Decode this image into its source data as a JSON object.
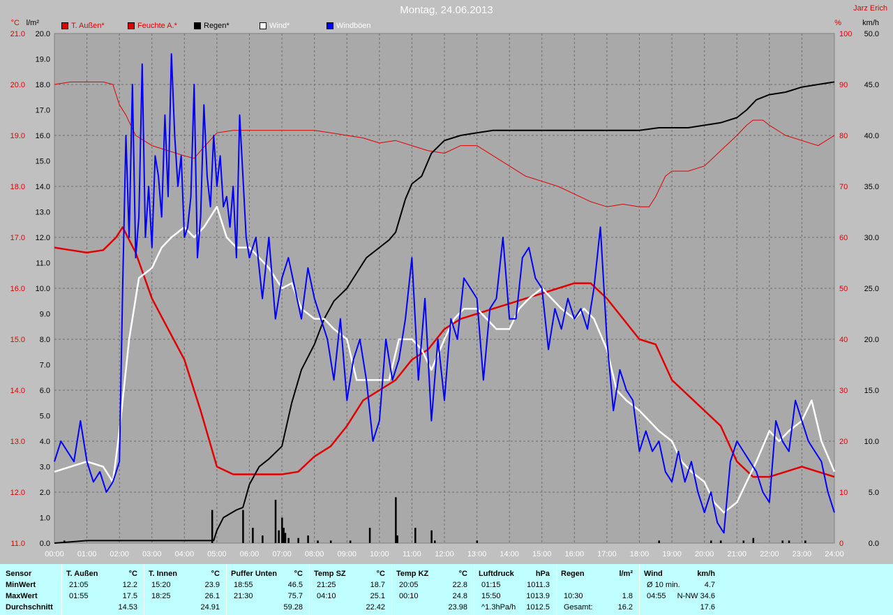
{
  "title": "Montag, 24.06.2013",
  "author": "Jarz Erich",
  "units": {
    "left_temp": "°C",
    "left_rain": "l/m²",
    "right_humidity": "%",
    "right_wind": "km/h"
  },
  "legend": [
    {
      "label": "T. Außen*",
      "color": "#e00000",
      "text_color": "#e00000"
    },
    {
      "label": "Feuchte A.*",
      "color": "#e00000",
      "text_color": "#e00000"
    },
    {
      "label": "Regen*",
      "color": "#000000",
      "text_color": "#000000"
    },
    {
      "label": "Wind*",
      "color": "#ffffff",
      "text_color": "#ffffff"
    },
    {
      "label": "Windböen",
      "color": "#0000ff",
      "text_color": "#ffffff"
    }
  ],
  "chart_data": {
    "type": "line",
    "title": "Montag, 24.06.2013",
    "grid": true,
    "legend_position": "top",
    "x_ticks": [
      "00:00",
      "01:00",
      "02:00",
      "03:00",
      "04:00",
      "05:00",
      "06:00",
      "07:00",
      "08:00",
      "09:00",
      "10:00",
      "11:00",
      "12:00",
      "13:00",
      "14:00",
      "15:00",
      "16:00",
      "17:00",
      "18:00",
      "19:00",
      "20:00",
      "21:00",
      "22:00",
      "23:00",
      "24:00"
    ],
    "xlim": [
      0,
      24
    ],
    "axes": {
      "temp": {
        "unit": "°C",
        "ylim": [
          11.0,
          21.0
        ],
        "ticks": [
          "11.0",
          "12.0",
          "13.0",
          "14.0",
          "15.0",
          "16.0",
          "17.0",
          "18.0",
          "19.0",
          "20.0",
          "21.0"
        ]
      },
      "rain": {
        "unit": "l/m²",
        "ylim": [
          0.0,
          20.0
        ],
        "ticks": [
          "0.0",
          "1.0",
          "2.0",
          "3.0",
          "4.0",
          "5.0",
          "6.0",
          "7.0",
          "8.0",
          "9.0",
          "10.0",
          "11.0",
          "12.0",
          "13.0",
          "14.0",
          "15.0",
          "16.0",
          "17.0",
          "18.0",
          "19.0",
          "20.0"
        ]
      },
      "humidity": {
        "unit": "%",
        "ylim": [
          0,
          100
        ],
        "ticks": [
          "0",
          "10",
          "20",
          "30",
          "40",
          "50",
          "60",
          "70",
          "80",
          "90",
          "100"
        ]
      },
      "wind": {
        "unit": "km/h",
        "ylim": [
          0.0,
          50.0
        ],
        "ticks": [
          "0.0",
          "5.0",
          "10.0",
          "15.0",
          "20.0",
          "25.0",
          "30.0",
          "35.0",
          "40.0",
          "45.0",
          "50.0"
        ]
      }
    },
    "series": [
      {
        "name": "T. Außen*",
        "axis": "temp",
        "color": "#e00000",
        "width": 2.5,
        "x": [
          0,
          0.5,
          1,
          1.5,
          1.9,
          2.1,
          2.5,
          3,
          3.5,
          4,
          4.5,
          5,
          5.5,
          6,
          6.5,
          7,
          7.5,
          8,
          8.5,
          9,
          9.5,
          10,
          10.5,
          11,
          11.5,
          12,
          12.5,
          13,
          13.5,
          14,
          14.5,
          15,
          15.5,
          16,
          16.5,
          17,
          17.5,
          18,
          18.5,
          19,
          19.5,
          20,
          20.5,
          21,
          21.5,
          22,
          22.5,
          23,
          23.5,
          24
        ],
        "y": [
          16.8,
          16.75,
          16.7,
          16.75,
          17.0,
          17.2,
          16.7,
          15.8,
          15.2,
          14.6,
          13.6,
          12.5,
          12.35,
          12.35,
          12.35,
          12.35,
          12.4,
          12.7,
          12.9,
          13.3,
          13.8,
          14.0,
          14.2,
          14.6,
          14.8,
          15.2,
          15.4,
          15.5,
          15.6,
          15.7,
          15.8,
          15.9,
          16.0,
          16.1,
          16.1,
          15.8,
          15.4,
          15.0,
          14.9,
          14.2,
          13.9,
          13.6,
          13.3,
          12.6,
          12.3,
          12.3,
          12.4,
          12.5,
          12.4,
          12.3
        ]
      },
      {
        "name": "Feuchte A.*",
        "axis": "humidity",
        "color": "#e00000",
        "width": 1,
        "x": [
          0,
          0.5,
          1,
          1.5,
          1.8,
          2,
          2.2,
          2.5,
          3,
          3.5,
          4,
          4.3,
          4.5,
          5,
          5.5,
          6,
          6.5,
          7,
          7.5,
          8,
          8.5,
          9,
          9.5,
          10,
          10.5,
          11,
          11.5,
          12,
          12.5,
          13,
          13.5,
          14,
          14.5,
          15,
          15.5,
          16,
          16.5,
          17,
          17.5,
          18,
          18.3,
          18.5,
          18.8,
          19,
          19.5,
          20,
          20.5,
          21,
          21.3,
          21.5,
          21.8,
          22,
          22.5,
          23,
          23.5,
          24
        ],
        "y": [
          90,
          90.5,
          90.5,
          90.5,
          90,
          86,
          84,
          80,
          78,
          77,
          76,
          75.5,
          77,
          80.5,
          81,
          81,
          81,
          81,
          81,
          81,
          80.5,
          80,
          79.5,
          78.5,
          79,
          78,
          77,
          76.5,
          78,
          78,
          76,
          74,
          72,
          71,
          70,
          68.5,
          67,
          66,
          66.5,
          66,
          66,
          68,
          72,
          73,
          73,
          74,
          77,
          80,
          82,
          83,
          83,
          82,
          80,
          79,
          78,
          80
        ]
      },
      {
        "name": "Regen*",
        "axis": "rain",
        "color": "#000000",
        "width": 2,
        "x": [
          0,
          0.5,
          1,
          2,
          3,
          4,
          4.9,
          5.0,
          5.2,
          5.6,
          5.8,
          6,
          6.3,
          6.6,
          7,
          7.3,
          7.6,
          8,
          8.3,
          8.6,
          9,
          9.3,
          9.6,
          10,
          10.3,
          10.5,
          10.8,
          11,
          11.3,
          11.6,
          12,
          12.5,
          13,
          13.5,
          14,
          15,
          16,
          17,
          18,
          18.6,
          19,
          19.5,
          20,
          20.5,
          21,
          21.3,
          21.6,
          22,
          22.5,
          23,
          23.5,
          24
        ],
        "y": [
          0,
          0.05,
          0.1,
          0.1,
          0.1,
          0.1,
          0.1,
          0.5,
          1.0,
          1.3,
          1.4,
          2.3,
          3.0,
          3.3,
          3.8,
          5.5,
          6.8,
          7.8,
          8.8,
          9.5,
          10.0,
          10.6,
          11.2,
          11.6,
          11.9,
          12.2,
          13.5,
          14.1,
          14.4,
          15.3,
          15.8,
          16.0,
          16.1,
          16.2,
          16.2,
          16.2,
          16.2,
          16.2,
          16.2,
          16.3,
          16.3,
          16.3,
          16.4,
          16.5,
          16.7,
          17.0,
          17.4,
          17.6,
          17.7,
          17.9,
          18.0,
          18.1
        ]
      },
      {
        "name": "Wind*",
        "axis": "wind",
        "color": "#ffffff",
        "width": 2.5,
        "x": [
          0,
          0.5,
          1,
          1.5,
          1.8,
          2,
          2.3,
          2.6,
          3,
          3.3,
          3.6,
          4,
          4.3,
          4.6,
          5,
          5.3,
          5.6,
          6,
          6.3,
          6.6,
          7,
          7.3,
          7.6,
          8,
          8.3,
          8.6,
          9,
          9.3,
          9.6,
          10,
          10.3,
          10.6,
          11,
          11.3,
          11.6,
          12,
          12.3,
          12.6,
          13,
          13.3,
          13.6,
          14,
          14.3,
          14.6,
          15,
          15.3,
          15.6,
          16,
          16.3,
          16.6,
          17,
          17.3,
          17.6,
          18,
          18.3,
          18.6,
          19,
          19.3,
          19.6,
          20,
          20.3,
          20.6,
          21,
          21.3,
          21.6,
          22,
          22.3,
          22.6,
          23,
          23.3,
          23.6,
          24
        ],
        "y": [
          7,
          7.5,
          8,
          7.5,
          6,
          11,
          20,
          26,
          27,
          29,
          30,
          31,
          30,
          31,
          33,
          30,
          29,
          29,
          28,
          27,
          25,
          25.5,
          23,
          22,
          22,
          21,
          20,
          16,
          16,
          16,
          16,
          20,
          20,
          19,
          17,
          20,
          22,
          23,
          23,
          22,
          21,
          21,
          23,
          24,
          25,
          24,
          23,
          22,
          23,
          22,
          19,
          15,
          14,
          13,
          12,
          11,
          10,
          8,
          7,
          6,
          4,
          3,
          4,
          6,
          8,
          11,
          10,
          11,
          12,
          14,
          10,
          7
        ]
      },
      {
        "name": "Windböen",
        "axis": "wind",
        "color": "#0000ff",
        "width": 2,
        "x": [
          0,
          0.2,
          0.4,
          0.6,
          0.8,
          1,
          1.2,
          1.4,
          1.6,
          1.8,
          2,
          2.1,
          2.2,
          2.3,
          2.4,
          2.5,
          2.6,
          2.7,
          2.8,
          2.9,
          3,
          3.1,
          3.2,
          3.3,
          3.4,
          3.5,
          3.6,
          3.7,
          3.8,
          3.9,
          4,
          4.1,
          4.2,
          4.3,
          4.4,
          4.5,
          4.6,
          4.7,
          4.8,
          4.9,
          5,
          5.1,
          5.2,
          5.3,
          5.4,
          5.5,
          5.6,
          5.7,
          5.8,
          5.9,
          6,
          6.2,
          6.4,
          6.6,
          6.8,
          7,
          7.2,
          7.4,
          7.6,
          7.8,
          8,
          8.2,
          8.4,
          8.6,
          8.8,
          9,
          9.2,
          9.4,
          9.6,
          9.8,
          10,
          10.2,
          10.4,
          10.6,
          10.8,
          11,
          11.2,
          11.4,
          11.6,
          11.8,
          12,
          12.2,
          12.4,
          12.6,
          12.8,
          13,
          13.2,
          13.4,
          13.6,
          13.8,
          14,
          14.2,
          14.4,
          14.6,
          14.8,
          15,
          15.2,
          15.4,
          15.6,
          15.8,
          16,
          16.2,
          16.4,
          16.6,
          16.8,
          17,
          17.2,
          17.4,
          17.6,
          17.8,
          18,
          18.2,
          18.4,
          18.6,
          18.8,
          19,
          19.2,
          19.4,
          19.6,
          19.8,
          20,
          20.2,
          20.4,
          20.6,
          20.8,
          21,
          21.2,
          21.4,
          21.6,
          21.8,
          22,
          22.2,
          22.4,
          22.6,
          22.8,
          23,
          23.2,
          23.4,
          23.6,
          23.8,
          24
        ],
        "y": [
          8,
          10,
          9,
          8,
          12,
          8,
          6,
          7,
          5,
          6,
          8,
          25,
          40,
          30,
          45,
          28,
          32,
          47,
          30,
          35,
          29,
          38,
          36,
          32,
          42,
          34,
          48,
          40,
          35,
          38,
          30,
          31,
          34,
          45,
          28,
          32,
          43,
          36,
          33,
          40,
          35,
          38,
          33,
          34,
          31,
          35,
          28,
          42,
          36,
          30,
          28,
          30,
          24,
          30,
          22,
          26,
          28,
          25,
          22,
          27,
          24,
          22,
          20,
          16,
          22,
          14,
          18,
          20,
          16,
          10,
          12,
          20,
          16,
          18,
          22,
          28,
          16,
          24,
          12,
          20,
          14,
          22,
          20,
          26,
          25,
          24,
          16,
          23,
          24,
          30,
          22,
          22,
          28,
          29,
          26,
          25,
          19,
          23,
          21,
          24,
          22,
          23,
          21,
          25,
          31,
          20,
          13,
          17,
          15,
          14,
          9,
          11,
          9,
          10,
          7,
          6,
          9,
          6,
          8,
          5,
          3,
          5,
          2,
          1,
          8,
          10,
          9,
          8,
          7,
          5,
          4,
          12,
          10,
          9,
          14,
          12,
          10,
          9,
          8,
          5,
          3
        ]
      }
    ],
    "rain_bars": {
      "axis": "rain",
      "color": "#000000",
      "x": [
        0.3,
        4.85,
        5.8,
        6.1,
        6.4,
        6.8,
        6.9,
        7.0,
        7.05,
        7.1,
        7.2,
        7.5,
        7.8,
        8.1,
        8.5,
        9.1,
        9.7,
        10.5,
        10.55,
        11.1,
        11.6,
        11.7,
        13.0,
        18.6,
        20.2,
        20.5,
        21.2,
        21.5,
        22.4,
        22.6,
        23.1
      ],
      "values": [
        0.1,
        1.3,
        1.3,
        0.6,
        0.3,
        1.7,
        0.5,
        1.0,
        0.6,
        0.4,
        0.2,
        0.2,
        0.3,
        0.1,
        0.1,
        0.1,
        0.6,
        1.8,
        0.3,
        0.6,
        0.5,
        0.1,
        0.1,
        0.1,
        0.1,
        0.1,
        0.1,
        0.2,
        0.1,
        0.1,
        0.1
      ]
    }
  },
  "stats": {
    "row_labels": [
      "Sensor",
      "MinWert",
      "MaxWert",
      "Durchschnitt"
    ],
    "columns": [
      {
        "name": "T. Außen",
        "unit": "°C",
        "min_time": "21:05",
        "min": "12.2",
        "max_time": "01:55",
        "max": "17.5",
        "avg_time": "",
        "avg": "14.53"
      },
      {
        "name": "T. Innen",
        "unit": "°C",
        "min_time": "15:20",
        "min": "23.9",
        "max_time": "18:25",
        "max": "26.1",
        "avg_time": "",
        "avg": "24.91"
      },
      {
        "name": "Puffer Unten",
        "unit": "°C",
        "min_time": "18:55",
        "min": "46.5",
        "max_time": "21:30",
        "max": "75.7",
        "avg_time": "",
        "avg": "59.28"
      },
      {
        "name": "Temp SZ",
        "unit": "°C",
        "min_time": "21:25",
        "min": "18.7",
        "max_time": "04:10",
        "max": "25.1",
        "avg_time": "",
        "avg": "22.42"
      },
      {
        "name": "Temp KZ",
        "unit": "°C",
        "min_time": "20:05",
        "min": "22.8",
        "max_time": "00:10",
        "max": "24.8",
        "avg_time": "",
        "avg": "23.98"
      },
      {
        "name": "Luftdruck",
        "unit": "hPa",
        "min_time": "01:15",
        "min": "1011.3",
        "max_time": "15:50",
        "max": "1013.9",
        "avg_time": "^1.3hPa/h",
        "avg": "1012.5"
      },
      {
        "name": "Regen",
        "unit": "l/m²",
        "min_time": "",
        "min": "",
        "max_time": "10:30",
        "max": "1.8",
        "avg_time": "Gesamt:",
        "avg": "16.2"
      },
      {
        "name": "Wind",
        "unit": "km/h",
        "min_time": "Ø 10 min.",
        "min": "4.7",
        "max_time": "04:55",
        "max": "N-NW 34.6",
        "avg_time": "",
        "avg": "17.6"
      }
    ]
  }
}
